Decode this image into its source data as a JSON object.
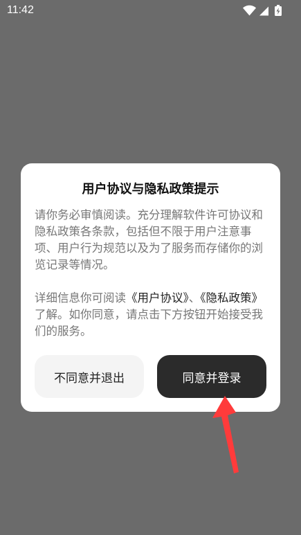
{
  "status_bar": {
    "time": "11:42"
  },
  "dialog": {
    "title": "用户协议与隐私政策提示",
    "paragraph1": "请你务必审慎阅读。充分理解软件许可协议和隐私政策各条款，包括但不限于用户注意事项、用户行为规范以及为了服务而存储你的浏览记录等情况。",
    "paragraph2_prefix": " 详细信息你可阅读",
    "user_agreement_link": "《用户协议》",
    "separator": "、",
    "privacy_policy_link": "《隐私政策》",
    "paragraph2_suffix": "了解。如你同意，请点击下方按钮开始接受我们的服务。",
    "decline_label": "不同意并退出",
    "accept_label": "同意并登录"
  },
  "colors": {
    "overlay": "#6b6b6b",
    "accept_button": "#2b2b2b",
    "decline_button": "#f4f4f4",
    "annotation_arrow": "#ff3b3b"
  }
}
